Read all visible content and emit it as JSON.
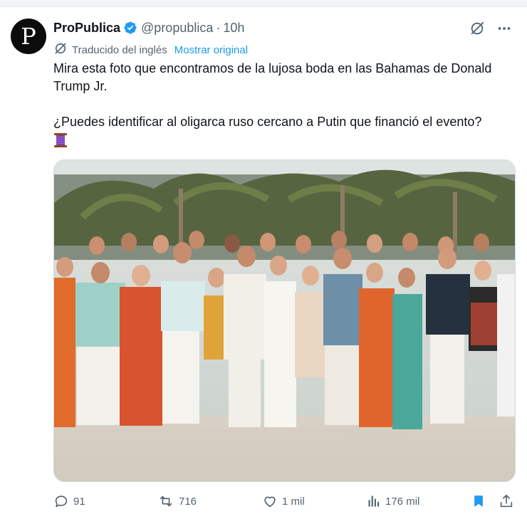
{
  "tweet": {
    "author_name": "ProPublica",
    "handle": "@propublica",
    "separator": "·",
    "time": "10h",
    "avatar_letter": "P",
    "translated_label": "Traducido del inglés",
    "show_original_label": "Mostrar original",
    "text_line1": "Mira esta foto que encontramos de la lujosa boda en las Bahamas de Donald Trump Jr.",
    "text_line2": "¿Puedes identificar al oligarca ruso cercano a Putin que financió el evento?",
    "emoji": "thread-spool-icon",
    "more_icon": "more-dots-icon",
    "grok_icon": "grok-icon"
  },
  "actions": {
    "replies": "91",
    "reposts": "716",
    "likes": "1 mil",
    "views": "176 mil"
  },
  "colors": {
    "text": "#0f1419",
    "secondary": "#536471",
    "link": "#1d9bf0",
    "verified": "#1d9bf0",
    "bookmark_active": "#1d9bf0"
  }
}
